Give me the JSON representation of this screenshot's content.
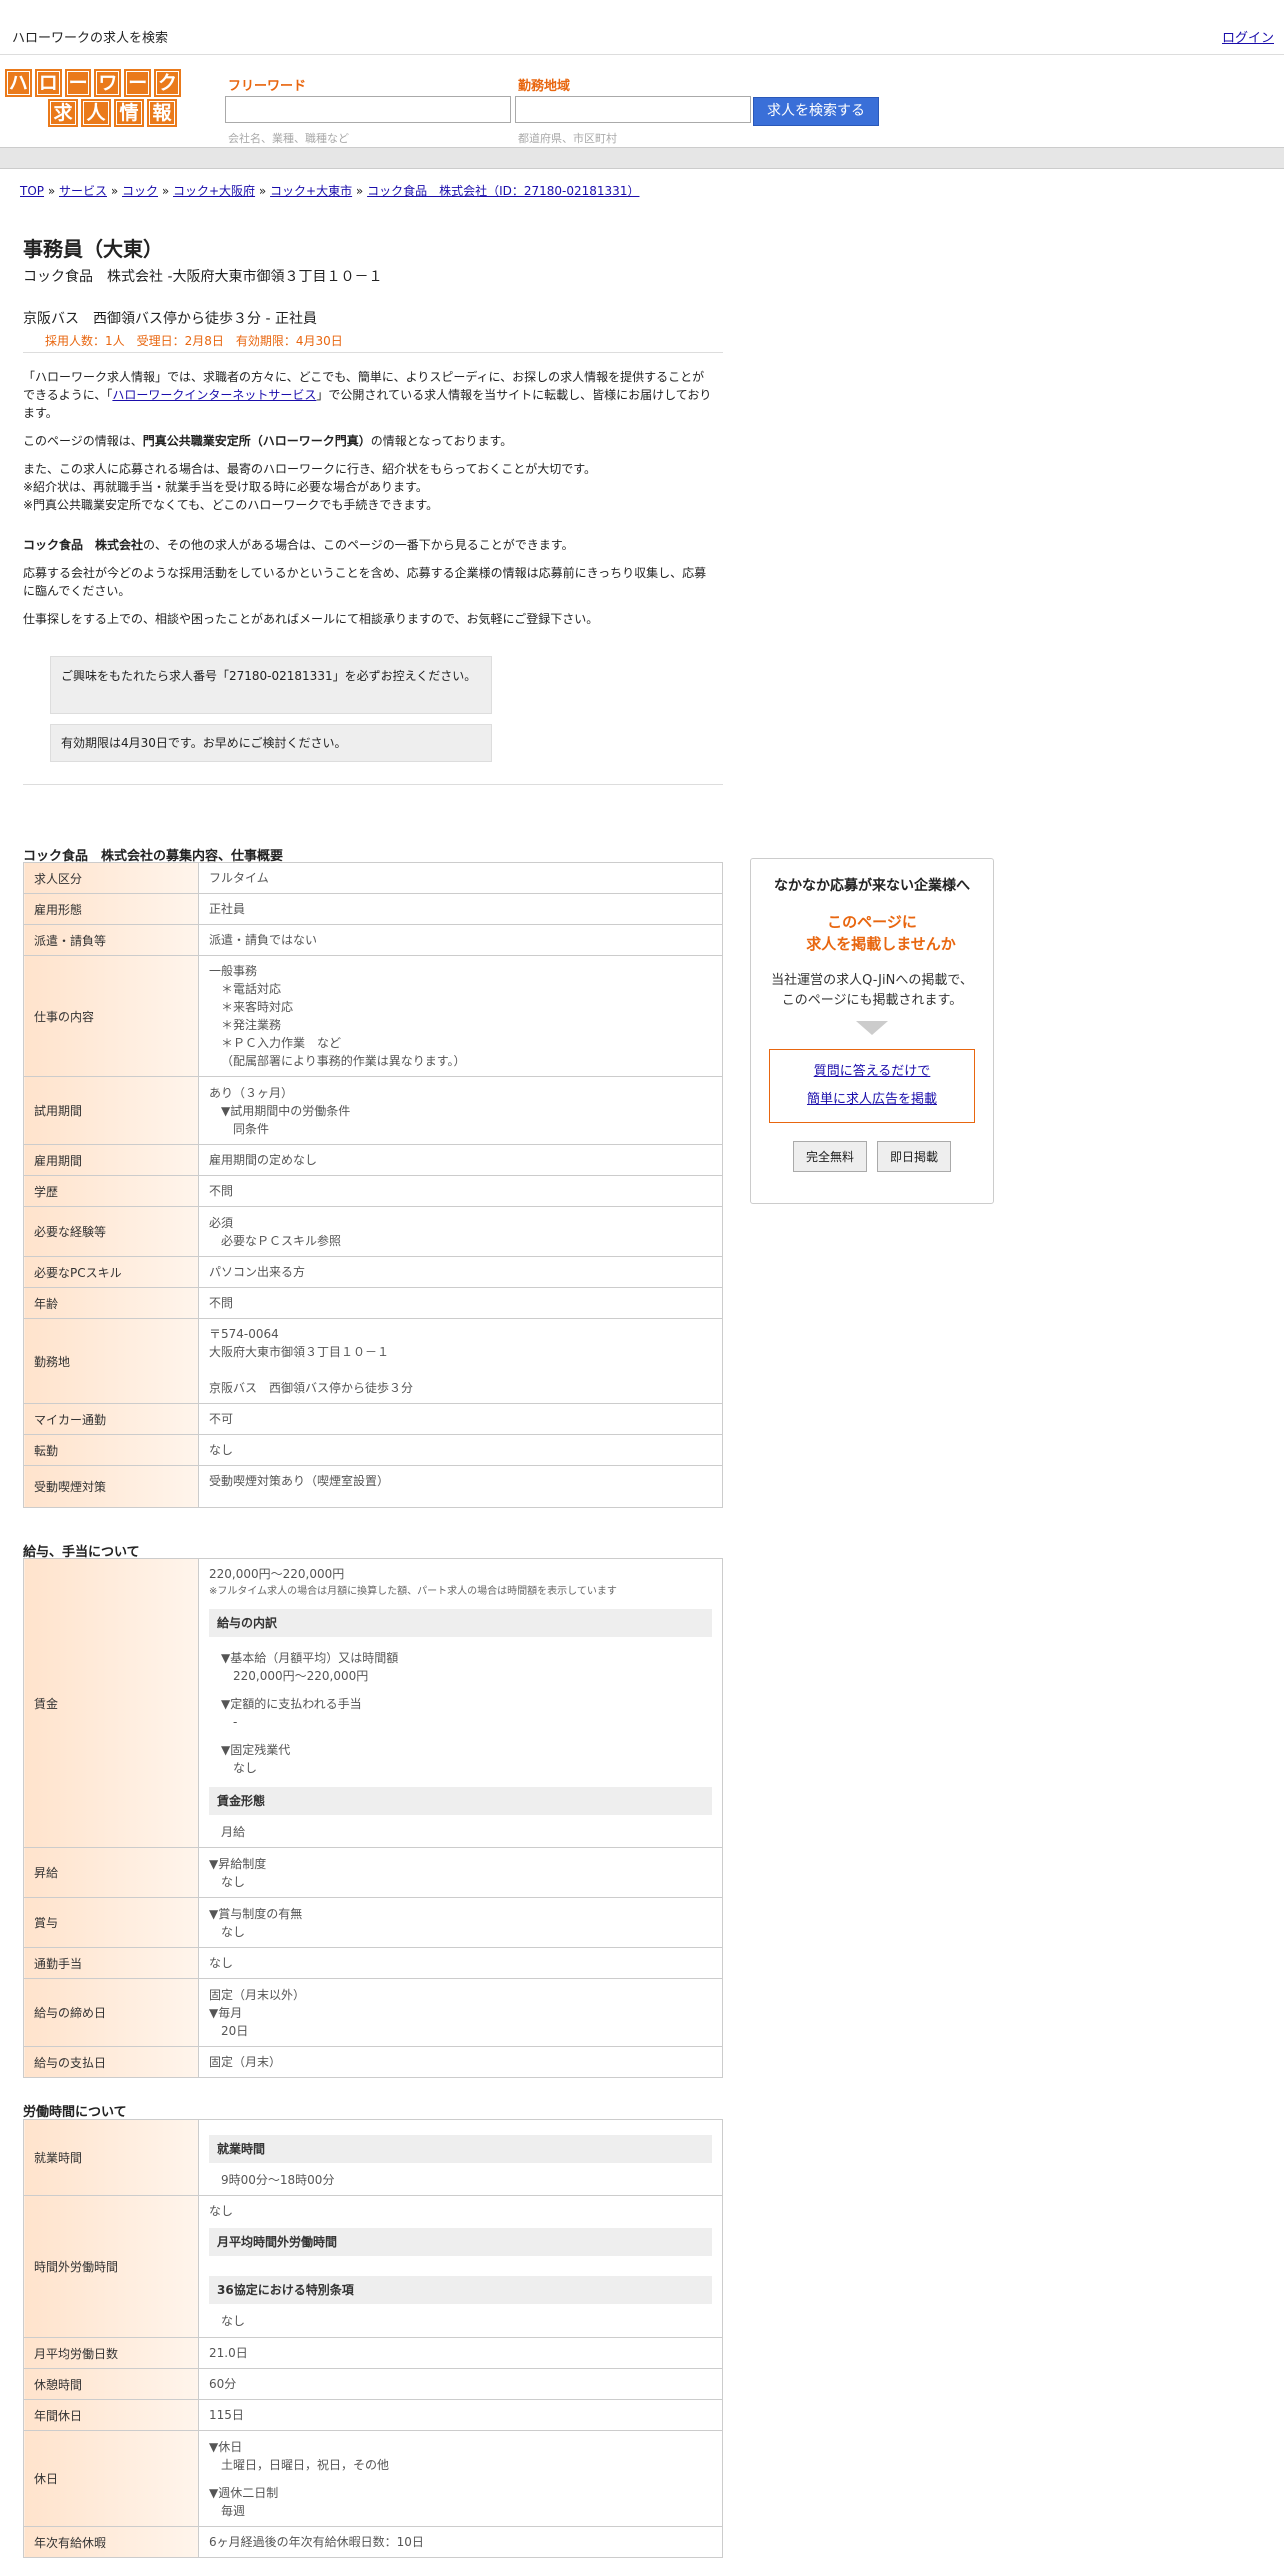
{
  "header": {
    "title": "ハローワークの求人を検索",
    "login": "ログイン"
  },
  "logo": {
    "row1": [
      "ハ",
      "ロ",
      "ー",
      "ワ",
      "ー",
      "ク"
    ],
    "row2": [
      "求",
      "人",
      "情",
      "報"
    ]
  },
  "search": {
    "freeword_label": "フリーワード",
    "freeword_placeholder": "会社名、業種、職種など",
    "area_label": "勤務地域",
    "area_placeholder": "都道府県、市区町村",
    "button": "求人を検索する"
  },
  "breadcrumb": [
    "TOP",
    "サービス",
    "コック",
    "コック+大阪府",
    "コック+大東市",
    "コック食品　株式会社（ID：27180-02181331）"
  ],
  "job": {
    "title": "事務員（大東）",
    "company_address": "コック食品　株式会社 -大阪府大東市御領３丁目１０－１",
    "access": "京阪バス　西御領バス停から徒歩３分 - 正社員",
    "meta": "採用人数：1人　受理日：2月8日　有効期限：4月30日"
  },
  "intro": {
    "p1a": "「ハローワーク求人情報」では、求職者の方々に、どこでも、簡単に、よりスピーディに、お探しの求人情報を提供することができるように、「",
    "p1link": "ハローワークインターネットサービス",
    "p1b": "」で公開されている求人情報を当サイトに転載し、皆様にお届けしております。",
    "p2a": "このページの情報は、",
    "p2b": "門真公共職業安定所（ハローワーク門真）",
    "p2c": "の情報となっております。",
    "p3": "また、この求人に応募される場合は、最寄のハローワークに行き、紹介状をもらっておくことが大切です。",
    "p3b": "※紹介状は、再就職手当・就業手当を受け取る時に必要な場合があります。",
    "p3c": "※門真公共職業安定所でなくても、どこのハローワークでも手続きできます。",
    "p4a": "コック食品　株式会社",
    "p4b": "の、その他の求人がある場合は、このページの一番下から見ることができます。",
    "p5": "応募する会社が今どのような採用活動をしているかということを含め、応募する企業様の情報は応募前にきっちり収集し、応募に臨んでください。",
    "p6": "仕事探しをする上での、相談や困ったことがあればメールにて相談承りますので、お気軽にご登録下さい。"
  },
  "notes": {
    "n1": "ご興味をもたれたら求人番号「27180-02181331」を必ずお控えください。",
    "n2": "有効期限は4月30日です。お早めにご検討ください。"
  },
  "section1": {
    "title": "コック食品　株式会社の募集内容、仕事概要",
    "rows": {
      "kubun": [
        "求人区分",
        "フルタイム"
      ],
      "keitai": [
        "雇用形態",
        "正社員"
      ],
      "haken": [
        "派遣・請負等",
        "派遣・請負ではない"
      ],
      "naiyo_k": "仕事の内容",
      "naiyo": [
        "一般事務",
        "＊電話対応",
        "＊来客時対応",
        "＊発注業務",
        "＊ＰＣ入力作業　など",
        "（配属部署により事務的作業は異なります。）"
      ],
      "shiyo_k": "試用期間",
      "shiyo": [
        "あり（３ヶ月）",
        "▼試用期間中の労働条件",
        "同条件"
      ],
      "koyo": [
        "雇用期間",
        "雇用期間の定めなし"
      ],
      "gakureki": [
        "学歴",
        "不問"
      ],
      "keiken_k": "必要な経験等",
      "keiken": [
        "必須",
        "必要なＰＣスキル参照"
      ],
      "pc": [
        "必要なPCスキル",
        "パソコン出来る方"
      ],
      "nenrei": [
        "年齢",
        "不問"
      ],
      "kinmu_k": "勤務地",
      "kinmu": [
        "〒574-0064",
        "大阪府大東市御領３丁目１０－１",
        "京阪バス　西御領バス停から徒歩３分"
      ],
      "mycar": [
        "マイカー通勤",
        "不可"
      ],
      "tenkin": [
        "転勤",
        "なし"
      ],
      "judo": [
        "受動喫煙対策",
        "受動喫煙対策あり（喫煙室設置）"
      ]
    }
  },
  "section2": {
    "title": "給与、手当について",
    "chingin_k": "賃金",
    "chingin": "220,000円〜220,000円",
    "chingin_note": "※フルタイム求人の場合は月額に換算した額、パート求人の場合は時間額を表示しています",
    "uchiwake": "給与の内訳",
    "kihon": [
      "▼基本給（月額平均）又は時間額",
      "220,000円〜220,000円"
    ],
    "teigaku": [
      "▼定額的に支払われる手当",
      "-"
    ],
    "kotei": [
      "▼固定残業代",
      "なし"
    ],
    "keitai_t": "賃金形態",
    "keitai": "月給",
    "shokyu": [
      "昇給",
      "▼昇給制度",
      "なし"
    ],
    "shoyo": [
      "賞与",
      "▼賞与制度の有無",
      "なし"
    ],
    "tsukin": [
      "通勤手当",
      "なし"
    ],
    "shime": [
      "給与の締め日",
      "固定（月末以外）",
      "▼毎月",
      "20日"
    ],
    "shiharai": [
      "給与の支払日",
      "固定（月末）"
    ]
  },
  "section3": {
    "title": "労働時間について",
    "shugyo": [
      "就業時間",
      "就業時間",
      "9時00分〜18時00分"
    ],
    "jikangai": [
      "時間外労働時間",
      "なし",
      "月平均時間外労働時間",
      "36協定における特別条項",
      "なし"
    ],
    "nissu": [
      "月平均労働日数",
      "21.0日"
    ],
    "kyukei": [
      "休憩時間",
      "60分"
    ],
    "nenkan": [
      "年間休日",
      "115日"
    ],
    "kyujitsu": [
      "休日",
      "▼休日",
      "土曜日，日曜日，祝日，その他",
      "▼週休二日制",
      "毎週"
    ],
    "yukyu": [
      "年次有給休暇",
      "6ヶ月経過後の年次有給休暇日数：10日"
    ]
  },
  "sidebar": {
    "t1": "なかなか応募が来ない企業様へ",
    "t2a": "このページに",
    "t2b": "求人を掲載しませんか",
    "t3a": "当社運営の求人Q-JiNへの掲載で、",
    "t3b": "このページにも掲載されます。",
    "link1": "質問に答えるだけで",
    "link2": "簡単に求人広告を掲載",
    "btn1": "完全無料",
    "btn2": "即日掲載"
  }
}
